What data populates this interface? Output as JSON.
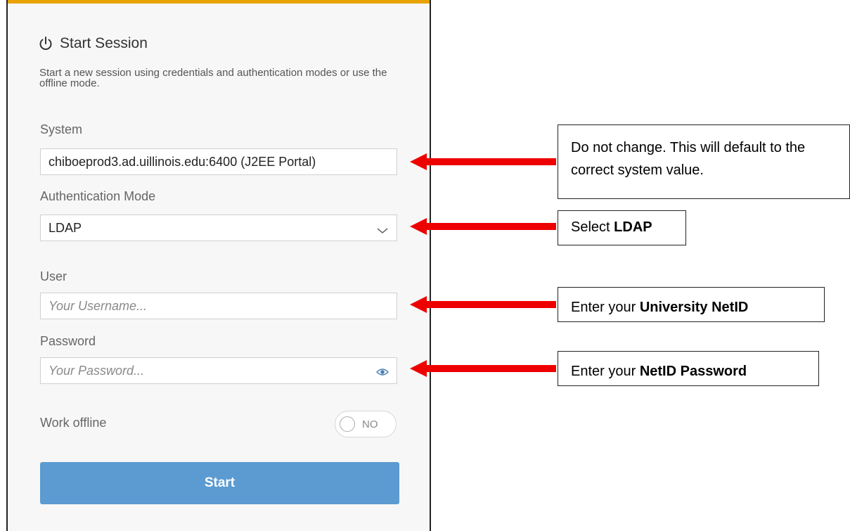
{
  "dialog": {
    "title": "Start Session",
    "description": "Start a new session using credentials and authentication modes or use the offline mode.",
    "system": {
      "label": "System",
      "value": "chiboeprod3.ad.uillinois.edu:6400 (J2EE Portal)"
    },
    "auth": {
      "label": "Authentication Mode",
      "value": "LDAP"
    },
    "user": {
      "label": "User",
      "placeholder": "Your Username..."
    },
    "password": {
      "label": "Password",
      "placeholder": "Your Password..."
    },
    "offline": {
      "label": "Work offline",
      "state": "NO"
    },
    "start_label": "Start",
    "icons": {
      "title": "power-icon",
      "auth": "chevron-down-icon",
      "password": "eye-icon"
    },
    "colors": {
      "accent_top": "#e8a300",
      "start_button": "#5b9bd1"
    }
  },
  "annotations": {
    "system_note": "Do not change. This will default to the correct system value.",
    "auth_prefix": "Select ",
    "auth_bold": "LDAP",
    "user_prefix": "Enter your ",
    "user_bold": "University NetID",
    "password_prefix": "Enter your ",
    "password_bold": "NetID Password",
    "arrow_color": "#ee0000"
  }
}
